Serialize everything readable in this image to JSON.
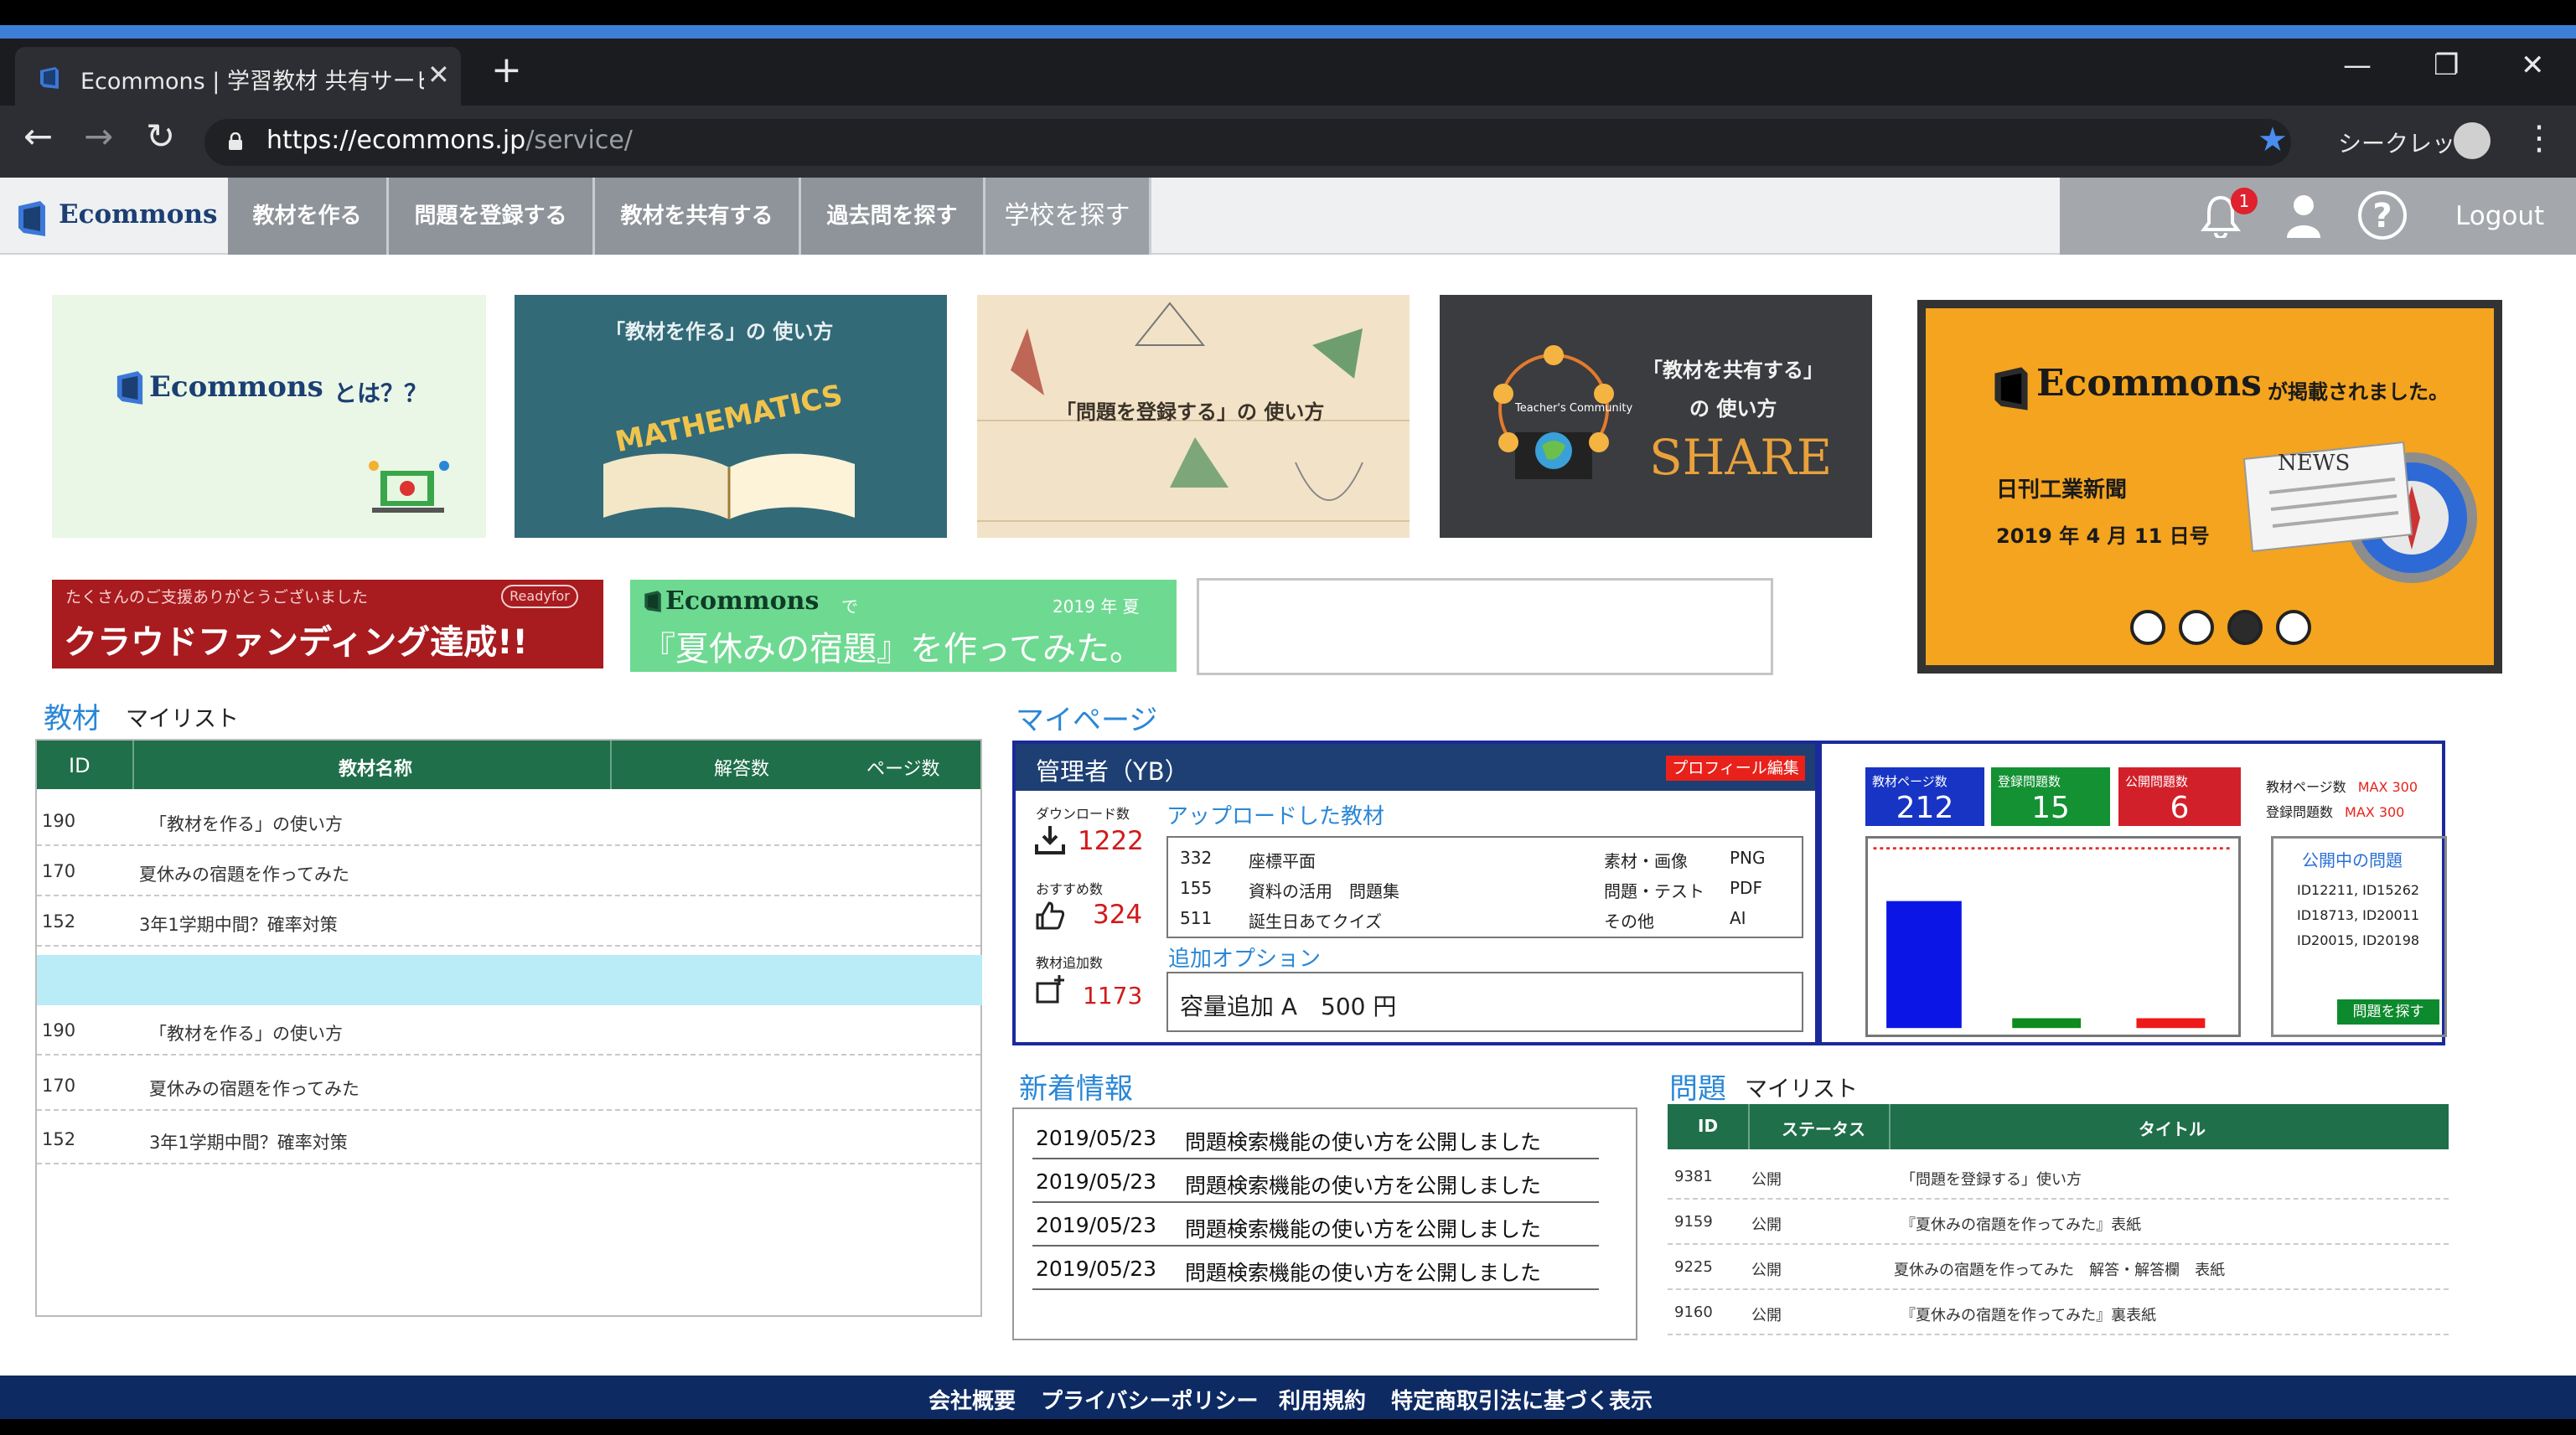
{
  "browser": {
    "tab_title": "Ecommons | 学習教材 共有サービ",
    "tab_close": "✕",
    "new_tab": "+",
    "url_host": "https://ecommons.jp",
    "url_path": "/service/",
    "incognito_label": "シークレット",
    "minimize": "—",
    "restore": "❐",
    "close": "✕",
    "back": "←",
    "forward": "→",
    "reload": "↻",
    "star": "★",
    "menu": "⋮"
  },
  "site": {
    "brand": "Ecommons",
    "nav": [
      "教材を作る",
      "問題を登録する",
      "教材を共有する",
      "過去問を探す",
      "学校を探す"
    ],
    "notification_count": "1",
    "help": "?",
    "logout": "Logout"
  },
  "banners": {
    "about": {
      "brand": "Ecommons",
      "suffix": "とは？？"
    },
    "make": {
      "title": "「教材を作る」の 使い方",
      "word": "MATHEMATICS"
    },
    "register": {
      "title": "「問題を登録する」の 使い方"
    },
    "share": {
      "line1": "「教材を共有する」",
      "line2": "の 使い方",
      "word": "SHARE",
      "community": "Teacher's Community"
    },
    "crowdfunding": {
      "top": "たくさんのご支援ありがとうございました",
      "tag": "Readyfor",
      "main": "クラウドファンディング達成!!"
    },
    "summer": {
      "brand": "Ecommons",
      "de": "で",
      "year": "2019 年 夏",
      "main": "『夏休みの宿題』を作ってみた。"
    },
    "carousel": {
      "brand": "Ecommons",
      "headline": "が掲載されました。",
      "paper": "日刊工業新聞",
      "date": "2019 年 4 月 11 日号",
      "news": "NEWS",
      "active_dot": 3,
      "dots": 4
    }
  },
  "materials": {
    "title": "教材",
    "subtitle": "マイリスト",
    "columns": [
      "ID",
      "教材名称",
      "解答数",
      "ページ数"
    ],
    "rows": [
      {
        "id": "190",
        "name": "「教材を作る」の使い方"
      },
      {
        "id": "170",
        "name": "夏休みの宿題を作ってみた"
      },
      {
        "id": "152",
        "name": "3年1学期中間？確率対策"
      },
      {
        "id": "",
        "name": ""
      },
      {
        "id": "190",
        "name": "「教材を作る」の使い方"
      },
      {
        "id": "170",
        "name": "夏休みの宿題を作ってみた"
      },
      {
        "id": "152",
        "name": "3年1学期中間？確率対策"
      }
    ]
  },
  "mypage": {
    "title": "マイページ",
    "user": "管理者（YB）",
    "edit_profile": "プロフィール編集",
    "downloads_label": "ダウンロード数",
    "downloads": "1222",
    "recommend_label": "おすすめ数",
    "recommend": "324",
    "added_label": "教材追加数",
    "added": "1173",
    "uploaded_title": "アップロードした教材",
    "uploaded": [
      {
        "id": "332",
        "name": "座標平面",
        "category": "素材・画像",
        "type": "PNG"
      },
      {
        "id": "155",
        "name": "資料の活用　問題集",
        "category": "問題・テスト",
        "type": "PDF"
      },
      {
        "id": "511",
        "name": "誕生日あてクイズ",
        "category": "その他",
        "type": "AI"
      }
    ],
    "option_title": "追加オプション",
    "option_value": "容量追加 A　500 円"
  },
  "stats": {
    "kpis": [
      {
        "label": "教材ページ数",
        "value": "212",
        "color": "#1734c4"
      },
      {
        "label": "登録問題数",
        "value": "15",
        "color": "#139133"
      },
      {
        "label": "公開問題数",
        "value": "6",
        "color": "#d2202a"
      }
    ],
    "limits": [
      {
        "label": "教材ページ数",
        "value": "MAX 300"
      },
      {
        "label": "登録問題数",
        "value": "MAX 300"
      }
    ],
    "public_title": "公開中の問題",
    "public_ids": [
      "ID12211,  ID15262",
      "ID18713,  ID20011",
      "ID20015,  ID20198"
    ],
    "find_button": "問題を探す"
  },
  "chart_data": {
    "type": "bar",
    "categories": [
      "教材ページ数",
      "登録問題数",
      "公開問題数"
    ],
    "values": [
      212,
      15,
      6
    ],
    "colors": [
      "#0b16e6",
      "#0e8a1e",
      "#ee1a1a"
    ],
    "ylim": [
      0,
      300
    ],
    "limit_line": 300,
    "title": "",
    "xlabel": "",
    "ylabel": ""
  },
  "news": {
    "title": "新着情報",
    "items": [
      {
        "date": "2019/05/23",
        "text": "問題検索機能の使い方を公開しました"
      },
      {
        "date": "2019/05/23",
        "text": "問題検索機能の使い方を公開しました"
      },
      {
        "date": "2019/05/23",
        "text": "問題検索機能の使い方を公開しました"
      },
      {
        "date": "2019/05/23",
        "text": "問題検索機能の使い方を公開しました"
      }
    ]
  },
  "questions": {
    "title": "問題",
    "subtitle": "マイリスト",
    "columns": [
      "ID",
      "ステータス",
      "タイトル"
    ],
    "rows": [
      {
        "id": "9381",
        "status": "公開",
        "title": "「問題を登録する」使い方"
      },
      {
        "id": "9159",
        "status": "公開",
        "title": "『夏休みの宿題を作ってみた』表紙"
      },
      {
        "id": "9225",
        "status": "公開",
        "title": "夏休みの宿題を作ってみた　解答・解答欄　表紙"
      },
      {
        "id": "9160",
        "status": "公開",
        "title": "『夏休みの宿題を作ってみた』裏表紙"
      }
    ]
  },
  "footer": {
    "links": [
      "会社概要",
      "プライバシーポリシー",
      "利用規約",
      "特定商取引法に基づく表示"
    ]
  }
}
